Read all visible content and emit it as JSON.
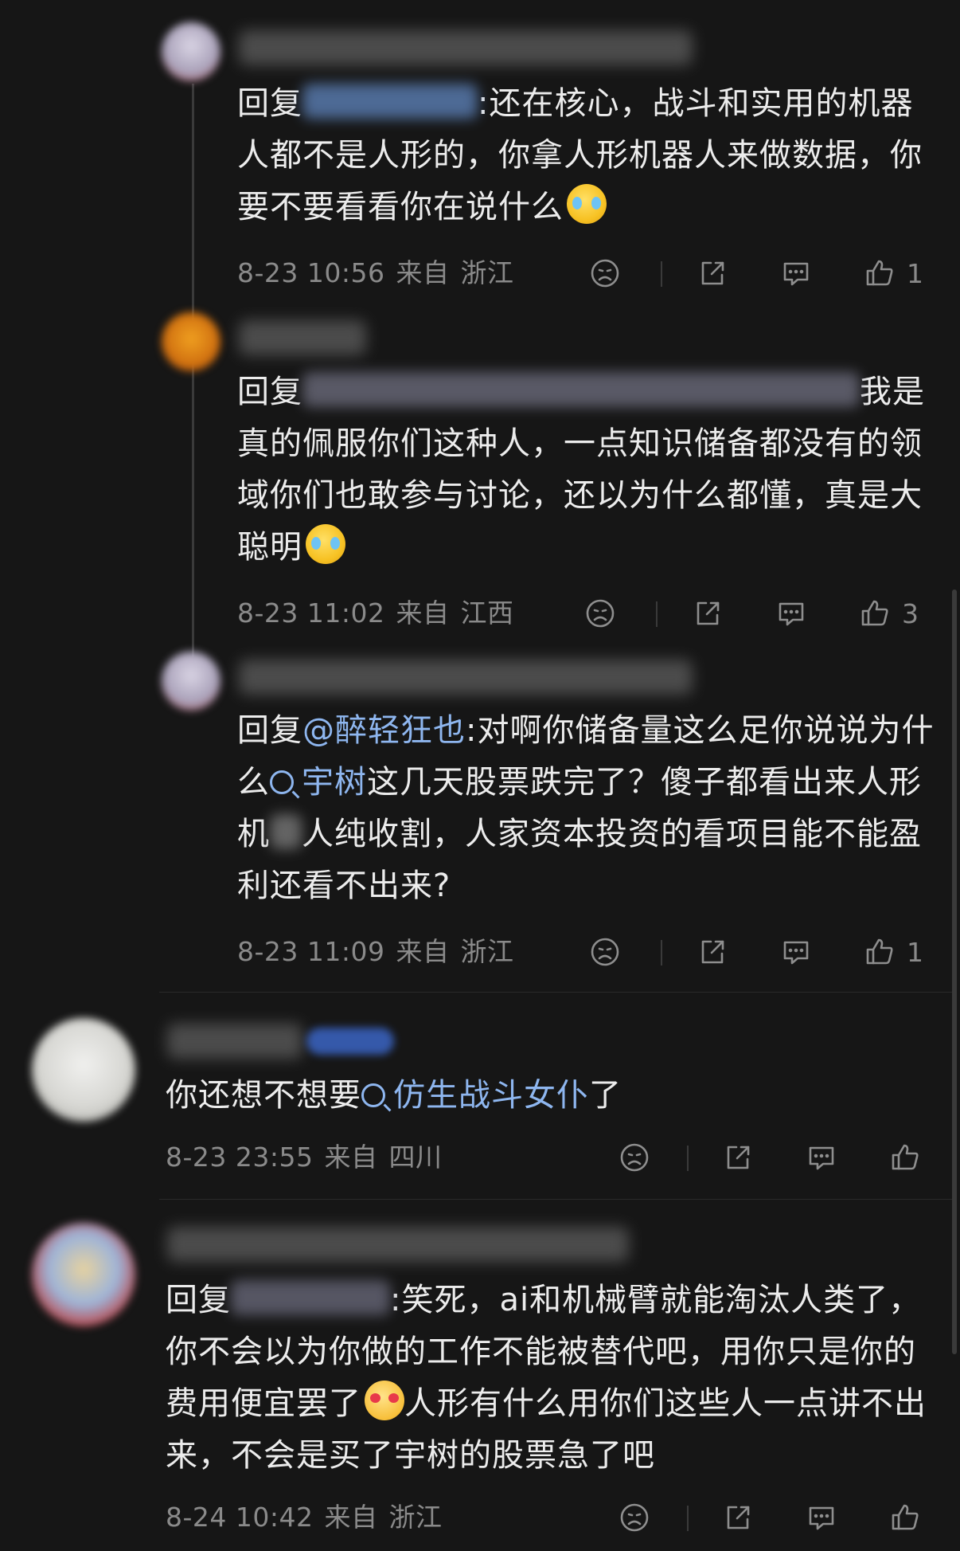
{
  "comments": [
    {
      "reply_prefix": "回复",
      "text_after_mention": ":还在核心，战斗和实用的机器人都不是人形的，你拿人形机器人来做数据，你要不要看看你在说什么",
      "time": "8-23 10:56",
      "from": "来自",
      "location": "浙江",
      "likes": "1"
    },
    {
      "reply_prefix": "回复",
      "text_after_mention": "我是真的佩服你们这种人，一点知识储备都没有的领域你们也敢参与讨论，还以为什么都懂，真是大聪明",
      "time": "8-23 11:02",
      "from": "来自",
      "location": "江西",
      "likes": "3"
    },
    {
      "reply_prefix": "回复",
      "mention": "@醉轻狂也",
      "text_1": ":对啊你储备量这么足你说说为什么",
      "topic": "宇树",
      "text_2": "这几天股票跌完了？傻子都看出来人形机",
      "text_3": "人纯收割，人家资本投资的看项目能不能盈利还看不出来?",
      "time": "8-23 11:09",
      "from": "来自",
      "location": "浙江",
      "likes": "1"
    },
    {
      "text_1": "你还想不想要",
      "topic": "仿生战斗女仆",
      "text_2": "了",
      "time": "8-23 23:55",
      "from": "来自",
      "location": "四川",
      "likes": ""
    },
    {
      "reply_prefix": "回复",
      "text_1": ":笑死，ai和机械臂就能淘汰人类了，你不会以为你做的工作不能被替代吧，用你只是你的费用便宜罢了",
      "text_2": "人形有什么用你们这些人一点讲不出来，不会是买了宇树的股票急了吧",
      "time": "8-24 10:42",
      "from": "来自",
      "location": "浙江",
      "likes": ""
    }
  ],
  "icons": {
    "dislike": "sad-face-icon",
    "share": "share-icon",
    "comment": "comment-icon",
    "like": "thumbs-up-icon",
    "emoji_laugh": "laughing-crying-emoji",
    "emoji_love": "smiling-hearts-emoji"
  },
  "colors": {
    "background": "#161616",
    "text": "#ececec",
    "link": "#8eb6ef",
    "meta": "#8a8a8a"
  }
}
